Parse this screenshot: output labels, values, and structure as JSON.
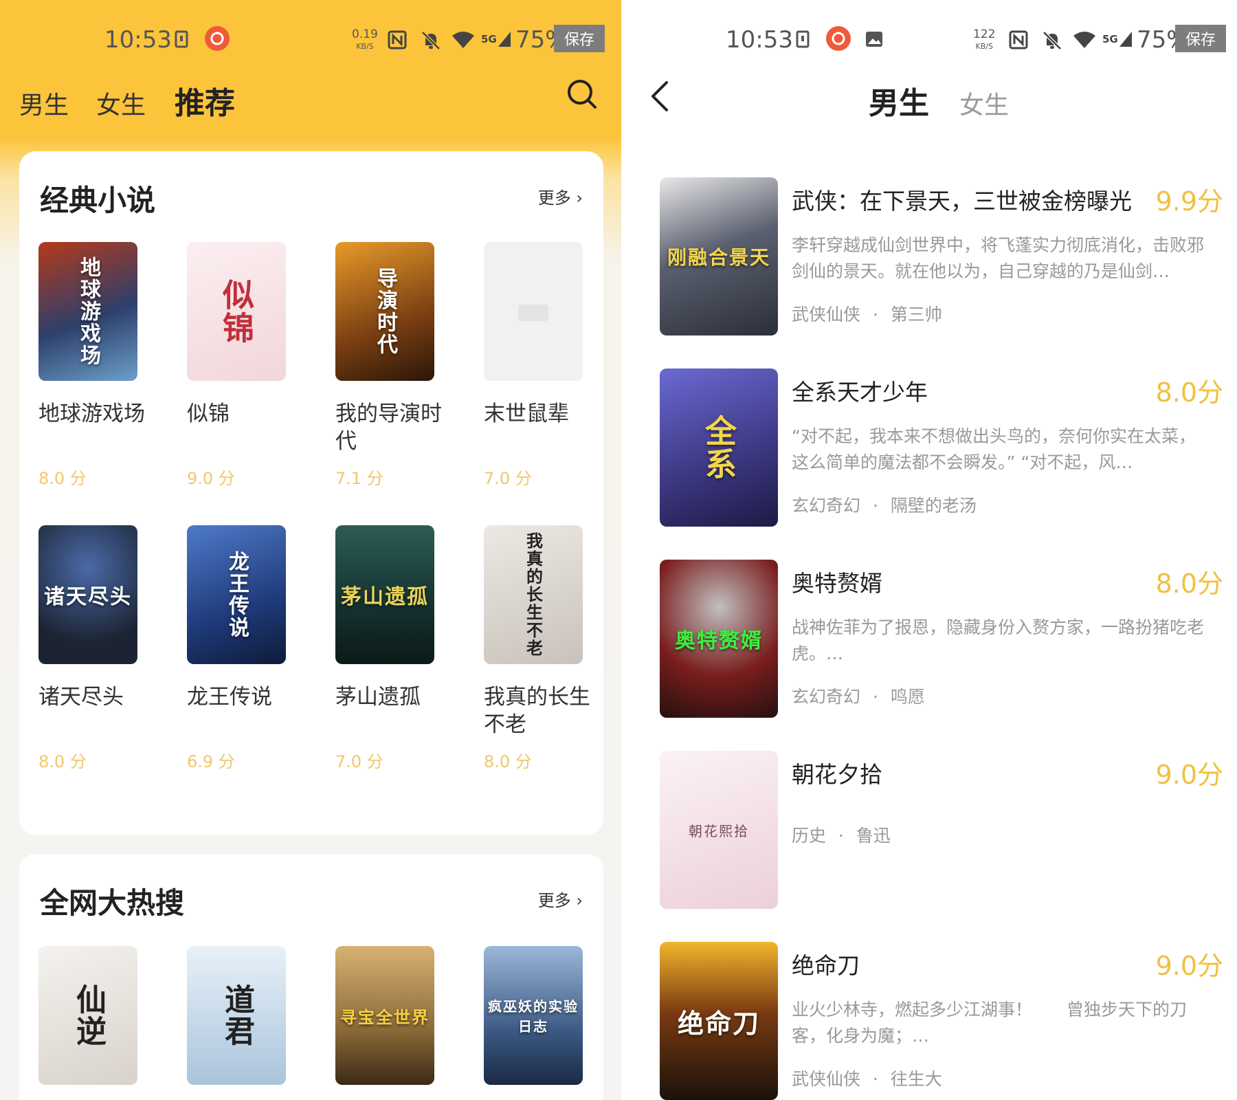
{
  "left": {
    "status": {
      "time": "10:53",
      "net_speed": "0.19",
      "net_unit": "KB/S",
      "network": "5G",
      "battery": "75%",
      "save_label": "保存"
    },
    "tabs": [
      {
        "label": "男生"
      },
      {
        "label": "女生"
      },
      {
        "label": "推荐"
      }
    ],
    "sections": [
      {
        "title": "经典小说",
        "more": "更多 ›",
        "books": [
          {
            "title": "地球游戏场",
            "score": "8.0 分",
            "cover_text": "地球游戏场",
            "cover_color": "#2e3f6b"
          },
          {
            "title": "似锦",
            "score": "9.0 分",
            "cover_text": "似锦",
            "cover_color": "#f6e3e6"
          },
          {
            "title": "我的导演时代",
            "score": "7.1 分",
            "cover_text": "导演时代",
            "cover_color": "#7a3f12"
          },
          {
            "title": "末世鼠辈",
            "score": "7.0 分",
            "cover_text": "",
            "cover_color": "#f1f1f1"
          },
          {
            "title": "诸天尽头",
            "score": "8.0 分",
            "cover_text": "诸天尽头",
            "cover_color": "#1c2433"
          },
          {
            "title": "龙王传说",
            "score": "6.9 分",
            "cover_text": "龙王传说",
            "cover_color": "#1f3b7a"
          },
          {
            "title": "茅山遗孤",
            "score": "7.0 分",
            "cover_text": "茅山遗孤",
            "cover_color": "#15312f"
          },
          {
            "title": "我真的长生不老",
            "score": "8.0 分",
            "cover_text": "我真的长生不老",
            "cover_color": "#d9d4cf"
          }
        ]
      },
      {
        "title": "全网大热搜",
        "more": "更多 ›",
        "books": [
          {
            "cover_text": "仙逆",
            "cover_color": "#e9e6e2"
          },
          {
            "cover_text": "道君",
            "cover_color": "#cfe0ee"
          },
          {
            "cover_text": "寻宝全世界",
            "cover_color": "#8c6a3a"
          },
          {
            "cover_text": "疯巫妖的实验日志",
            "cover_color": "#3d5b86"
          }
        ]
      }
    ]
  },
  "right": {
    "status": {
      "time": "10:53",
      "net_speed": "122",
      "net_unit": "KB/S",
      "network": "5G",
      "battery": "75%",
      "save_label": "保存"
    },
    "tabs": [
      {
        "label": "男生"
      },
      {
        "label": "女生"
      }
    ],
    "list": [
      {
        "title": "武侠：在下景天，三世被金榜曝光",
        "score": "9.9分",
        "desc": "李轩穿越成仙剑世界中，将飞蓬实力彻底消化，击败邪剑仙的景天。就在他以为，自己穿越的乃是仙剑…",
        "category": "武侠仙侠",
        "author": "第三帅",
        "cover_text": "刚融合景天",
        "cover_color": "#2b2f38"
      },
      {
        "title": "全系天才少年",
        "score": "8.0分",
        "desc": "“对不起，我本来不想做出头鸟的，奈何你实在太菜，这么简单的魔法都不会瞬发。” “对不起，风…",
        "category": "玄幻奇幻",
        "author": "隔壁的老汤",
        "cover_text": "全系",
        "cover_color": "#3f3a86"
      },
      {
        "title": "奥特赘婿",
        "score": "8.0分",
        "desc": "战神佐菲为了报恩，隐藏身份入赘方家，一路扮猪吃老虎。…",
        "category": "玄幻奇幻",
        "author": "鸣愿",
        "cover_text": "奥特赘婿",
        "cover_color": "#7a1d1d"
      },
      {
        "title": "朝花夕拾",
        "score": "9.0分",
        "desc": "",
        "category": "历史",
        "author": "鲁迅",
        "cover_text": "朝花熙拾",
        "cover_color": "#f3e4ea"
      },
      {
        "title": "绝命刀",
        "score": "9.0分",
        "desc": "业火少林寺，燃起多少江湖事！　　曾独步天下的刀客，化身为魔；…",
        "category": "武侠仙侠",
        "author": "往生大",
        "cover_text": "绝命刀",
        "cover_color": "#3a2a1a"
      }
    ],
    "meta_separator": "·"
  }
}
